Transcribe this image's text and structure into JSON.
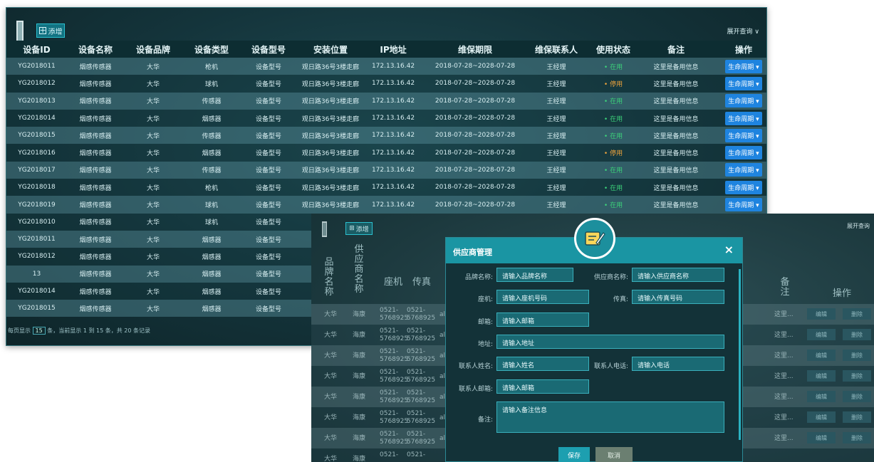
{
  "device_panel": {
    "add_label": "添增",
    "expand_label": "展开查询",
    "headers": [
      "设备ID",
      "设备名称",
      "设备品牌",
      "设备类型",
      "设备型号",
      "安装位置",
      "IP地址",
      "维保期限",
      "维保联系人",
      "使用状态",
      "备注",
      "操作"
    ],
    "rows": [
      {
        "id": "YG2018011",
        "name": "烟感传感器",
        "brand": "大华",
        "type": "枪机",
        "model": "设备型号",
        "location": "观日路36号3楼走廊",
        "ip": "172.13.16.42",
        "period": "2018-07-28~2028-07-28",
        "contact": "王经理",
        "status": "在用",
        "remark": "这里是备用信息",
        "action": "生命周期"
      },
      {
        "id": "YG2018012",
        "name": "烟感传感器",
        "brand": "大华",
        "type": "球机",
        "model": "设备型号",
        "location": "观日路36号3楼走廊",
        "ip": "172.13.16.42",
        "period": "2018-07-28~2028-07-28",
        "contact": "王经理",
        "status": "停用",
        "remark": "这里是备用信息",
        "action": "生命周期"
      },
      {
        "id": "YG2018013",
        "name": "烟感传感器",
        "brand": "大华",
        "type": "传感器",
        "model": "设备型号",
        "location": "观日路36号3楼走廊",
        "ip": "172.13.16.42",
        "period": "2018-07-28~2028-07-28",
        "contact": "王经理",
        "status": "在用",
        "remark": "这里是备用信息",
        "action": "生命周期"
      },
      {
        "id": "YG2018014",
        "name": "烟感传感器",
        "brand": "大华",
        "type": "烟感器",
        "model": "设备型号",
        "location": "观日路36号3楼走廊",
        "ip": "172.13.16.42",
        "period": "2018-07-28~2028-07-28",
        "contact": "王经理",
        "status": "在用",
        "remark": "这里是备用信息",
        "action": "生命周期"
      },
      {
        "id": "YG2018015",
        "name": "烟感传感器",
        "brand": "大华",
        "type": "传感器",
        "model": "设备型号",
        "location": "观日路36号3楼走廊",
        "ip": "172.13.16.42",
        "period": "2018-07-28~2028-07-28",
        "contact": "王经理",
        "status": "在用",
        "remark": "这里是备用信息",
        "action": "生命周期"
      },
      {
        "id": "YG2018016",
        "name": "烟感传感器",
        "brand": "大华",
        "type": "烟感器",
        "model": "设备型号",
        "location": "观日路36号3楼走廊",
        "ip": "172.13.16.42",
        "period": "2018-07-28~2028-07-28",
        "contact": "王经理",
        "status": "停用",
        "remark": "这里是备用信息",
        "action": "生命周期"
      },
      {
        "id": "YG2018017",
        "name": "烟感传感器",
        "brand": "大华",
        "type": "传感器",
        "model": "设备型号",
        "location": "观日路36号3楼走廊",
        "ip": "172.13.16.42",
        "period": "2018-07-28~2028-07-28",
        "contact": "王经理",
        "status": "在用",
        "remark": "这里是备用信息",
        "action": "生命周期"
      },
      {
        "id": "YG2018018",
        "name": "烟感传感器",
        "brand": "大华",
        "type": "枪机",
        "model": "设备型号",
        "location": "观日路36号3楼走廊",
        "ip": "172.13.16.42",
        "period": "2018-07-28~2028-07-28",
        "contact": "王经理",
        "status": "在用",
        "remark": "这里是备用信息",
        "action": "生命周期"
      },
      {
        "id": "YG2018019",
        "name": "烟感传感器",
        "brand": "大华",
        "type": "球机",
        "model": "设备型号",
        "location": "观日路36号3楼走廊",
        "ip": "172.13.16.42",
        "period": "2018-07-28~2028-07-28",
        "contact": "王经理",
        "status": "在用",
        "remark": "这里是备用信息",
        "action": "生命周期"
      },
      {
        "id": "YG2018010",
        "name": "烟感传感器",
        "brand": "大华",
        "type": "球机",
        "model": "设备型号",
        "location": "观",
        "ip": "",
        "period": "",
        "contact": "",
        "status": "",
        "remark": "",
        "action": ""
      },
      {
        "id": "YG2018011",
        "name": "烟感传感器",
        "brand": "大华",
        "type": "烟感器",
        "model": "设备型号",
        "location": "观",
        "ip": "",
        "period": "",
        "contact": "",
        "status": "",
        "remark": "",
        "action": ""
      },
      {
        "id": "YG2018012",
        "name": "烟感传感器",
        "brand": "大华",
        "type": "烟感器",
        "model": "设备型号",
        "location": "观",
        "ip": "",
        "period": "",
        "contact": "",
        "status": "",
        "remark": "",
        "action": ""
      },
      {
        "id": "13",
        "name": "烟感传感器",
        "brand": "大华",
        "type": "烟感器",
        "model": "设备型号",
        "location": "观",
        "ip": "",
        "period": "",
        "contact": "",
        "status": "",
        "remark": "",
        "action": ""
      },
      {
        "id": "YG2018014",
        "name": "烟感传感器",
        "brand": "大华",
        "type": "烟感器",
        "model": "设备型号",
        "location": "观",
        "ip": "",
        "period": "",
        "contact": "",
        "status": "",
        "remark": "",
        "action": ""
      },
      {
        "id": "YG2018015",
        "name": "烟感传感器",
        "brand": "大华",
        "type": "烟感器",
        "model": "设备型号",
        "location": "观",
        "ip": "",
        "period": "",
        "contact": "",
        "status": "",
        "remark": "",
        "action": ""
      }
    ],
    "pager_prefix": "每页显示",
    "page_size": "15",
    "pager_suffix": "条，当前显示 1 到 15 条，共 20 条记录"
  },
  "supplier_panel": {
    "add_label": "添增",
    "expand_label": "展开查询",
    "col_brand": "品牌名称",
    "col_supplier": "供应商名称",
    "col_phone": "座机",
    "col_fax": "传真",
    "col_remark": "备注",
    "col_action": "操作",
    "rows": [
      {
        "brand": "大华",
        "supplier": "海康",
        "phone": "0521-5768925",
        "fax": "0521-5768925",
        "extra": "al",
        "remark": "这里...",
        "edit": "编辑",
        "delete": "删除"
      },
      {
        "brand": "大华",
        "supplier": "海康",
        "phone": "0521-5768925",
        "fax": "0521-5768925",
        "extra": "al",
        "remark": "这里...",
        "edit": "编辑",
        "delete": "删除"
      },
      {
        "brand": "大华",
        "supplier": "海康",
        "phone": "0521-5768925",
        "fax": "0521-5768925",
        "extra": "al",
        "remark": "这里...",
        "edit": "编辑",
        "delete": "删除"
      },
      {
        "brand": "大华",
        "supplier": "海康",
        "phone": "0521-5768925",
        "fax": "0521-5768925",
        "extra": "al",
        "remark": "这里...",
        "edit": "编辑",
        "delete": "删除"
      },
      {
        "brand": "大华",
        "supplier": "海康",
        "phone": "0521-5768925",
        "fax": "0521-5768925",
        "extra": "al",
        "remark": "这里...",
        "edit": "编辑",
        "delete": "删除"
      },
      {
        "brand": "大华",
        "supplier": "海康",
        "phone": "0521-5768925",
        "fax": "0521-5768925",
        "extra": "al",
        "remark": "这里...",
        "edit": "编辑",
        "delete": "删除"
      },
      {
        "brand": "大华",
        "supplier": "海康",
        "phone": "0521-5768925",
        "fax": "0521-5768925",
        "extra": "al",
        "remark": "这里...",
        "edit": "编辑",
        "delete": "删除"
      },
      {
        "brand": "大华",
        "supplier": "海康",
        "phone": "0521-",
        "fax": "0521-",
        "extra": "",
        "remark": "",
        "edit": "",
        "delete": ""
      }
    ]
  },
  "modal": {
    "title": "供应商管理",
    "close": "×",
    "brand_label": "品牌名称:",
    "brand_placeholder": "请输入品牌名称",
    "supplier_label": "供应商名称:",
    "supplier_placeholder": "请输入供应商名称",
    "phone_label": "座机:",
    "phone_placeholder": "请输入座机号码",
    "fax_label": "传真:",
    "fax_placeholder": "请输入传真号码",
    "email_label": "邮箱:",
    "email_placeholder": "请输入邮箱",
    "address_label": "地址:",
    "address_placeholder": "请输入地址",
    "contact_name_label": "联系人姓名:",
    "contact_name_placeholder": "请输入姓名",
    "contact_phone_label": "联系人电话:",
    "contact_phone_placeholder": "请输入电话",
    "contact_email_label": "联系人邮箱:",
    "contact_email_placeholder": "请输入邮箱",
    "remark_label": "备注:",
    "remark_placeholder": "请输入备注信息",
    "save_label": "保存",
    "cancel_label": "取消"
  },
  "colors": {
    "accent": "#1a95a3",
    "status_on": "#3cd27a",
    "status_off": "#f0a43c",
    "life_button": "#1f84df"
  }
}
